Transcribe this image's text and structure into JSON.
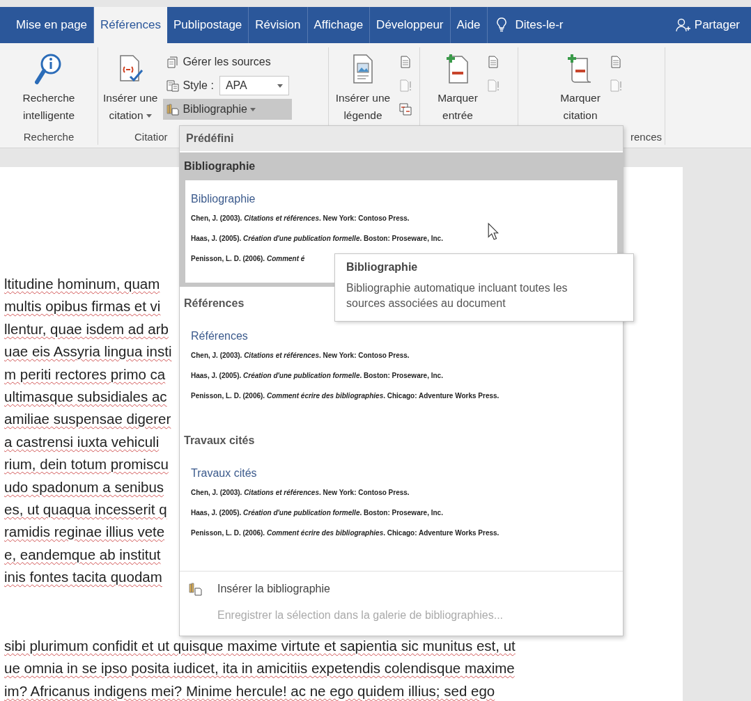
{
  "tabs": [
    {
      "label": "Mise en page",
      "selected": false
    },
    {
      "label": "Références",
      "selected": true
    },
    {
      "label": "Publipostage",
      "selected": false
    },
    {
      "label": "Révision",
      "selected": false
    },
    {
      "label": "Affichage",
      "selected": false
    },
    {
      "label": "Développeur",
      "selected": false
    },
    {
      "label": "Aide",
      "selected": false
    }
  ],
  "tell_me": {
    "label": "Dites-le-r"
  },
  "share": {
    "label": "Partager"
  },
  "ribbon": {
    "groups": [
      {
        "label": "Recherche",
        "large": {
          "lines": [
            "Recherche",
            "intelligente"
          ],
          "dropdown": false
        }
      },
      {
        "label": "Citatior",
        "large": {
          "lines": [
            "Insérer une",
            "citation"
          ],
          "dropdown": true
        },
        "small": [
          {
            "kind": "button",
            "label": "Gérer les sources"
          },
          {
            "kind": "combo",
            "label": "Style :",
            "value": "APA"
          },
          {
            "kind": "menu",
            "label": "Bibliographie",
            "expanded": true
          }
        ]
      },
      {
        "large": {
          "lines": [
            "Insérer une",
            "légende"
          ],
          "dropdown": false
        },
        "small": [
          {
            "kind": "icon",
            "disabled": false
          },
          {
            "kind": "icon",
            "disabled": true
          },
          {
            "kind": "icon",
            "disabled": false
          }
        ]
      },
      {
        "large": {
          "lines": [
            "Marquer",
            "entrée"
          ],
          "dropdown": false
        },
        "small": [
          {
            "kind": "icon",
            "disabled": false
          },
          {
            "kind": "icon",
            "disabled": true
          }
        ]
      },
      {
        "label": "rences",
        "large": {
          "lines": [
            "Marquer",
            "citation"
          ],
          "dropdown": false
        },
        "small": [
          {
            "kind": "icon",
            "disabled": false
          },
          {
            "kind": "icon",
            "disabled": true
          }
        ]
      }
    ]
  },
  "document": {
    "paragraphs": [
      {
        "lines": [
          "ltitudine hominum, quam",
          "multis opibus firmas et vi",
          "llentur, quae isdem ad arb",
          "uae eis Assyria lingua insti",
          "m periti rectores primo ca",
          "ultimasque subsidiales ac",
          "amiliae suspensae digerer",
          "a castrensi iuxta vehiculi",
          "rium, dein totum promiscu",
          "udo spadonum a senibus",
          "es, ut quaqua incesserit q",
          "ramidis reginae illius vete",
          "e, eandemque ab institut",
          "inis fontes tacita quodam"
        ]
      },
      {
        "lines": [
          "sibi plurimum confidit et ut quisque maxime virtute et sapientia sic munitus est, ut",
          "ue omnia in se ipso posita iudicet, ita in amicitiis expetendis colendisque maxime",
          "im? Africanus indigens mei? Minime hercule! ac ne ego quidem illius; sed ego"
        ]
      }
    ]
  },
  "gallery": {
    "header": "Prédéfini",
    "sections": [
      {
        "title": "Bibliographie",
        "selected": true,
        "preview": {
          "heading": "Bibliographie",
          "entries": [
            "Chen, J. (2003). *Citations et références*. New York: Contoso Press.",
            "Haas, J. (2005). *Création d'une publication formelle*. Boston: Proseware, Inc.",
            "Penisson, L. D. (2006). *Comment é*"
          ]
        }
      },
      {
        "title": "Références",
        "selected": false,
        "preview": {
          "heading": "Références",
          "entries": [
            "Chen, J. (2003). *Citations et références*. New York: Contoso Press.",
            "Haas, J. (2005). *Création d'une publication formelle*. Boston: Proseware, Inc.",
            "Penisson, L. D. (2006). *Comment écrire des bibliographies*. Chicago: Adventure Works Press."
          ]
        }
      },
      {
        "title": "Travaux cités",
        "selected": false,
        "preview": {
          "heading": "Travaux cités",
          "entries": [
            "Chen, J. (2003). *Citations et références*. New York: Contoso Press.",
            "Haas, J. (2005). *Création d'une publication formelle*. Boston: Proseware, Inc.",
            "Penisson, L. D. (2006). *Comment écrire des bibliographies*. Chicago: Adventure Works Press."
          ]
        }
      }
    ],
    "actions": [
      {
        "kind": "insert",
        "label": "Insérer la bibliographie",
        "disabled": false
      },
      {
        "kind": "save",
        "label": "Enregistrer la sélection dans la galerie de bibliographies...",
        "disabled": true
      }
    ]
  },
  "tooltip": {
    "title": "Bibliographie",
    "text": "Bibliographie automatique incluant toutes les sources associées au document"
  }
}
